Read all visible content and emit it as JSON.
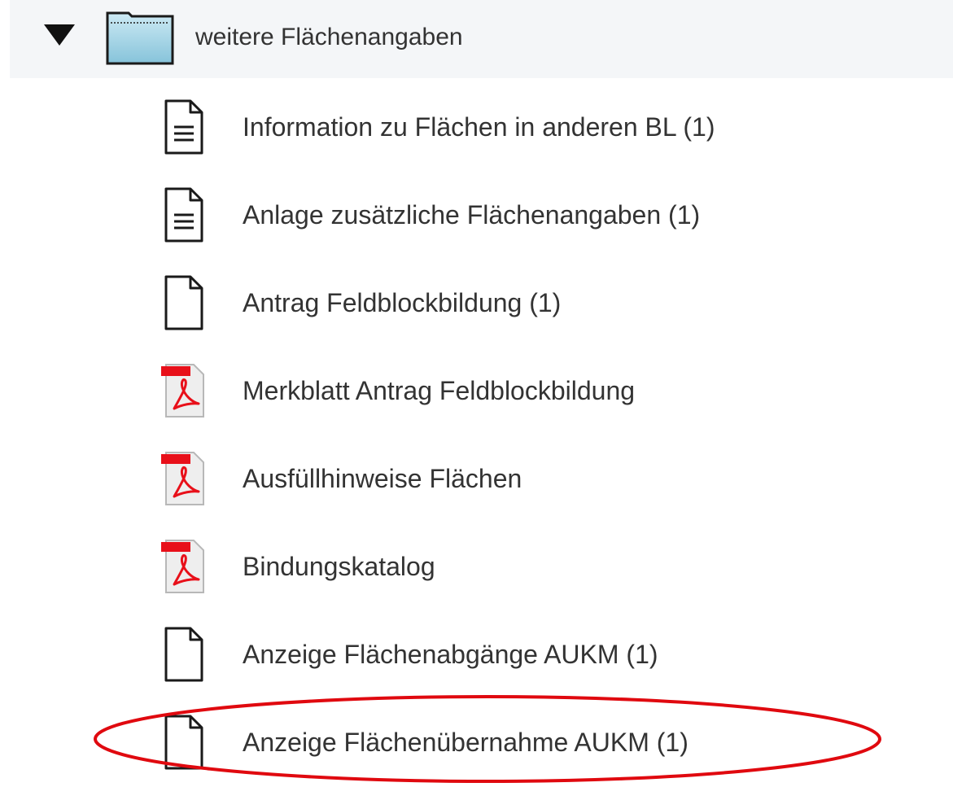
{
  "tree": {
    "folder": {
      "label": "weitere Flächenangaben",
      "expanded": true,
      "toggle_icon": "triangle-down-icon",
      "icon": "folder-icon"
    },
    "items": [
      {
        "label": "Information zu Flächen in anderen BL (1)",
        "icon": "document-lines-icon"
      },
      {
        "label": "Anlage zusätzliche Flächenangaben (1)",
        "icon": "document-lines-icon"
      },
      {
        "label": "Antrag Feldblockbildung (1)",
        "icon": "blank-document-icon"
      },
      {
        "label": "Merkblatt Antrag Feldblockbildung",
        "icon": "pdf-icon"
      },
      {
        "label": "Ausfüllhinweise Flächen",
        "icon": "pdf-icon"
      },
      {
        "label": "Bindungskatalog",
        "icon": "pdf-icon"
      },
      {
        "label": "Anzeige Flächenabgänge AUKM (1)",
        "icon": "blank-document-icon"
      },
      {
        "label": "Anzeige Flächenübernahme AUKM (1)",
        "icon": "blank-document-icon"
      }
    ],
    "highlighted_item": "Anzeige Flächenübernahme AUKM (1)"
  },
  "colors": {
    "folder_row_bg": "#f4f6f8",
    "text": "#333333",
    "highlight_ring": "#e0090f",
    "pdf_red": "#e8101a",
    "folder_fill": "#9fd3e6"
  }
}
